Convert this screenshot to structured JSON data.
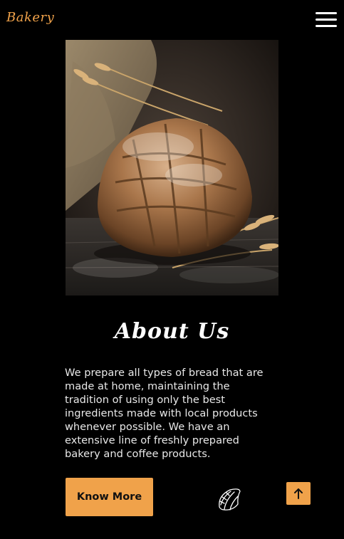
{
  "header": {
    "brand": "Bakery",
    "menu_icon": "hamburger-menu-icon"
  },
  "hero_image": {
    "subject": "bread-loaf-with-wheat-photo"
  },
  "about": {
    "title": "About Us",
    "text": "We prepare all types of bread that are made at home, maintaining the tradition of using only the best ingredients made with local products whenever possible. We have an extensive line of freshly prepared bakery and coffee products.",
    "button_label": "Know More",
    "decor_icon": "croissant-icon"
  },
  "scroll_top": {
    "icon": "arrow-up-icon"
  },
  "colors": {
    "accent": "#f0a24a",
    "background": "#000000",
    "text": "#ffffff"
  }
}
